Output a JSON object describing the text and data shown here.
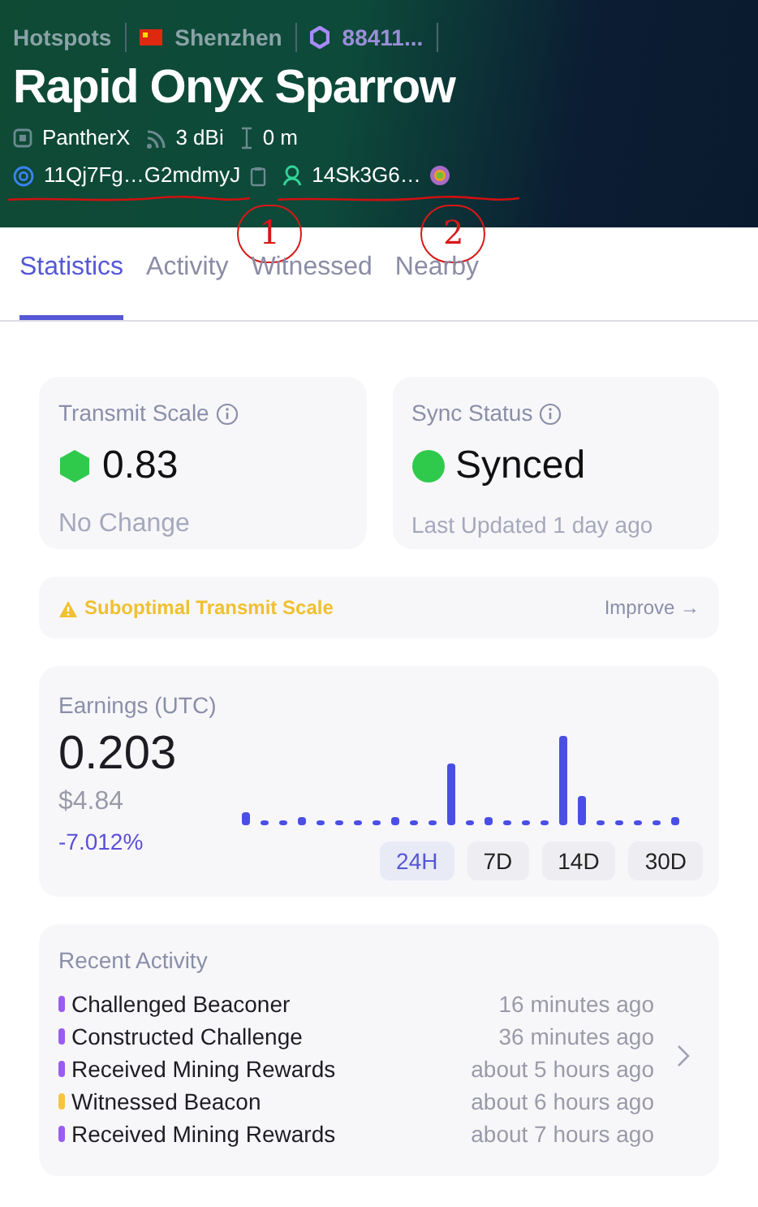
{
  "breadcrumb": [
    {
      "kind": "link",
      "label": "Hotspots"
    },
    {
      "kind": "flag",
      "label": "Shenzhen"
    },
    {
      "kind": "hex",
      "label": "88411..."
    }
  ],
  "title": "Rapid Onyx Sparrow",
  "specs": [
    {
      "kind": "maker",
      "label": "PantherX"
    },
    {
      "kind": "antenna",
      "label": "3 dBi"
    },
    {
      "kind": "elevation",
      "label": "0 m"
    }
  ],
  "addresses": [
    {
      "kind": "hotspot",
      "label": "11Qj7Fg…G2mdmyJ",
      "annotation": "1"
    },
    {
      "kind": "owner",
      "label": "14Sk3G6…",
      "annotation": "2"
    }
  ],
  "tabs": [
    {
      "label": "Statistics",
      "selected": true
    },
    {
      "label": "Activity",
      "selected": false
    },
    {
      "label": "Witnessed",
      "selected": false
    },
    {
      "label": "Nearby",
      "selected": false
    }
  ],
  "stats": [
    {
      "kind": "hex",
      "title": "Transmit Scale",
      "value": "0.83",
      "note": "No Change",
      "color": "#2fca4c"
    },
    {
      "kind": "dot",
      "title": "Sync Status",
      "value": "Synced",
      "note": "Last Updated 1 day ago",
      "color": "#2fca4c"
    }
  ],
  "warning": {
    "label": "Suboptimal Transmit Scale",
    "action": "Improve →"
  },
  "earnings": {
    "title": "Earnings (UTC)",
    "amount": "0.203",
    "usd": "$4.84",
    "change": "-7.012%",
    "ranges": [
      {
        "label": "24H",
        "selected": true
      },
      {
        "label": "7D",
        "selected": false
      },
      {
        "label": "14D",
        "selected": false
      },
      {
        "label": "30D",
        "selected": false
      }
    ]
  },
  "recent_activity": {
    "title": "Recent Activity",
    "items": [
      {
        "label": "Challenged Beaconer",
        "time": "16 minutes ago",
        "color": "#9b5cf0"
      },
      {
        "label": "Constructed Challenge",
        "time": "36 minutes ago",
        "color": "#9b5cf0"
      },
      {
        "label": "Received Mining Rewards",
        "time": "about 5 hours ago",
        "color": "#9b5cf0"
      },
      {
        "label": "Witnessed Beacon",
        "time": "about 6 hours ago",
        "color": "#f5c542"
      },
      {
        "label": "Received Mining Rewards",
        "time": "about 7 hours ago",
        "color": "#9b5cf0"
      }
    ]
  }
}
